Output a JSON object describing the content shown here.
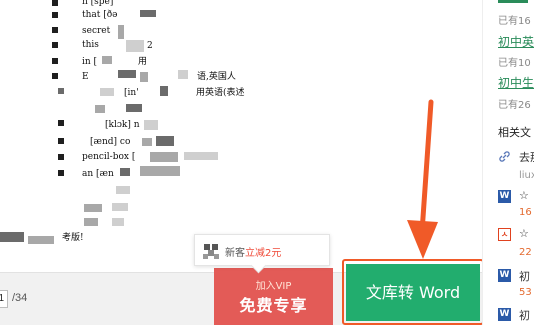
{
  "document": {
    "lines": [
      "n [spe]",
      "that [ðə",
      "secret",
      "this",
      "in [",
      "E",
      "[in'",
      "[klɔk] n",
      "[ænd] co",
      "pencil-box [",
      "an [æn",
      "语,英国人",
      "用英语(表述",
      "用",
      "2",
      "考版!"
    ]
  },
  "toolbar": {
    "page_current": "1",
    "page_total": "/34",
    "vip_label": "加入VIP",
    "vip_cta": "免费专享",
    "convert_label": "文库转 Word"
  },
  "tooltip": {
    "text": "新客",
    "highlight": "立减2元"
  },
  "sidebar": {
    "items": [
      {
        "title": "初中英",
        "meta": "已有16"
      },
      {
        "title": "初中英",
        "meta": "已有10"
      },
      {
        "title": "初中生",
        "meta": "已有26"
      }
    ],
    "related_heading": "相关文",
    "related": [
      {
        "icon": "link-icon",
        "title": "去那",
        "sub": "liux"
      },
      {
        "icon": "word-icon",
        "title": "☆",
        "sub": "16"
      },
      {
        "icon": "pdf-icon",
        "title": "☆",
        "sub": "22"
      },
      {
        "icon": "word-icon",
        "title": "初",
        "sub": "53"
      },
      {
        "icon": "word-icon",
        "title": "初",
        "sub": ""
      }
    ]
  },
  "colors": {
    "accent_green": "#22ad6e",
    "vip_red": "#e35b57",
    "annotation_orange": "#f05a28",
    "sidebar_green_link": "#2a8c5a"
  }
}
